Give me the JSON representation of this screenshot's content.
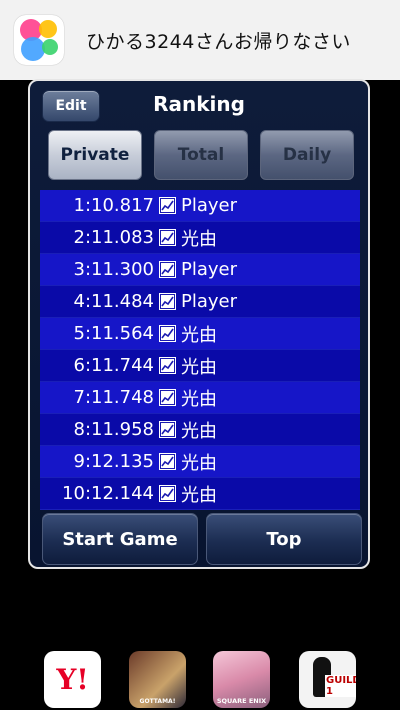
{
  "banner": {
    "icon": "game-center-icon",
    "message": "ひかる3244さんお帰りなさい"
  },
  "panel": {
    "edit_label": "Edit",
    "title": "Ranking",
    "tabs": [
      {
        "label": "Private",
        "state": "selected"
      },
      {
        "label": "Total",
        "state": "unselected"
      },
      {
        "label": "Daily",
        "state": "unselected"
      }
    ],
    "rankings": [
      {
        "time": "1:10.817",
        "icon": "chart-icon",
        "name": "Player"
      },
      {
        "time": "2:11.083",
        "icon": "chart-icon",
        "name": "光由"
      },
      {
        "time": "3:11.300",
        "icon": "chart-icon",
        "name": "Player"
      },
      {
        "time": "4:11.484",
        "icon": "chart-icon",
        "name": "Player"
      },
      {
        "time": "5:11.564",
        "icon": "chart-icon",
        "name": "光由"
      },
      {
        "time": "6:11.744",
        "icon": "chart-icon",
        "name": "光由"
      },
      {
        "time": "7:11.748",
        "icon": "chart-icon",
        "name": "光由"
      },
      {
        "time": "8:11.958",
        "icon": "chart-icon",
        "name": "光由"
      },
      {
        "time": "9:12.135",
        "icon": "chart-icon",
        "name": "光由"
      },
      {
        "time": "10:12.144",
        "icon": "chart-icon",
        "name": "光由"
      }
    ],
    "start_label": "Start Game",
    "top_label": "Top"
  },
  "apps": [
    {
      "icon": "yahoo-icon",
      "text": "Y!"
    },
    {
      "icon": "fighter-game-icon",
      "text": "GOTTAMA!"
    },
    {
      "icon": "anime-girl-game-icon",
      "text": "SQUARE ENIX"
    },
    {
      "icon": "guild-game-icon",
      "text": "GUILD 1"
    }
  ],
  "colors": {
    "banner_bg": "#f2f2f2",
    "row_odd": "#1616c8",
    "row_even": "#0a0aa8",
    "panel_bg": "#0e1c3a",
    "yahoo_red": "#e60026"
  }
}
